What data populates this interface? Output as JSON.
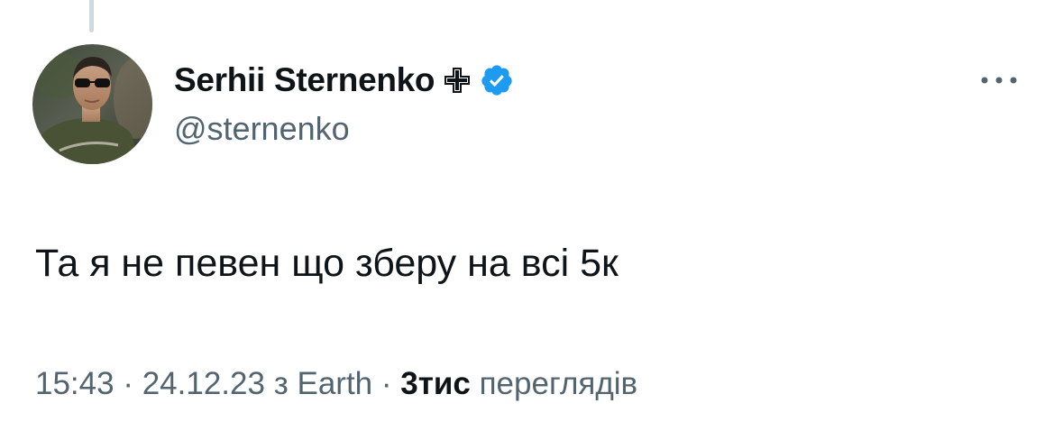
{
  "tweet": {
    "author": {
      "display_name": "Serhii Sternenko",
      "handle": "@sternenko",
      "badges": [
        "cross-icon",
        "verified-icon"
      ]
    },
    "text": "Та я не певен що зберу на всі 5к",
    "meta": {
      "time": "15:43",
      "separator": "·",
      "date": "24.12.23",
      "location": "з Earth",
      "views_count": "3тис",
      "views_label": "переглядів"
    },
    "more_icon": "more-horizontal-icon"
  },
  "colors": {
    "text_primary": "#0f1419",
    "text_secondary": "#536471",
    "verified_blue": "#1d9bf0",
    "thread_line": "#cfd9de"
  }
}
